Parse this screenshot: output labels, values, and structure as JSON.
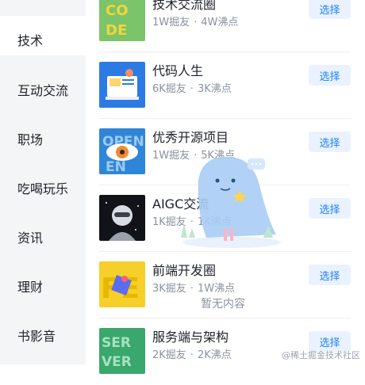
{
  "sidebar": {
    "items": [
      {
        "label": "技术"
      },
      {
        "label": "互动交流"
      },
      {
        "label": "职场"
      },
      {
        "label": "吃喝玩乐"
      },
      {
        "label": "资讯"
      },
      {
        "label": "理财"
      },
      {
        "label": "书影音"
      }
    ]
  },
  "circles": [
    {
      "title": "技术交流圈",
      "members": "1W掘友",
      "hot": "4W沸点",
      "button": "选择",
      "icon": "code-icon"
    },
    {
      "title": "代码人生",
      "members": "6K掘友",
      "hot": "3K沸点",
      "button": "选择",
      "icon": "coding-life-icon"
    },
    {
      "title": "优秀开源项目",
      "members": "1W掘友",
      "hot": "5K沸点",
      "button": "选择",
      "icon": "open-source-icon"
    },
    {
      "title": "AIGC交流",
      "members": "1K掘友",
      "hot": "1K沸点",
      "button": "选择",
      "icon": "aigc-icon"
    },
    {
      "title": "前端开发圈",
      "members": "3K掘友",
      "hot": "1W沸点",
      "button": "选择",
      "icon": "frontend-icon"
    },
    {
      "title": "服务端与架构",
      "members": "2K掘友",
      "hot": "2K沸点",
      "button": "选择",
      "icon": "server-icon"
    }
  ],
  "empty_state": {
    "text": "暂无内容"
  },
  "watermark": "@稀土掘金技术社区"
}
